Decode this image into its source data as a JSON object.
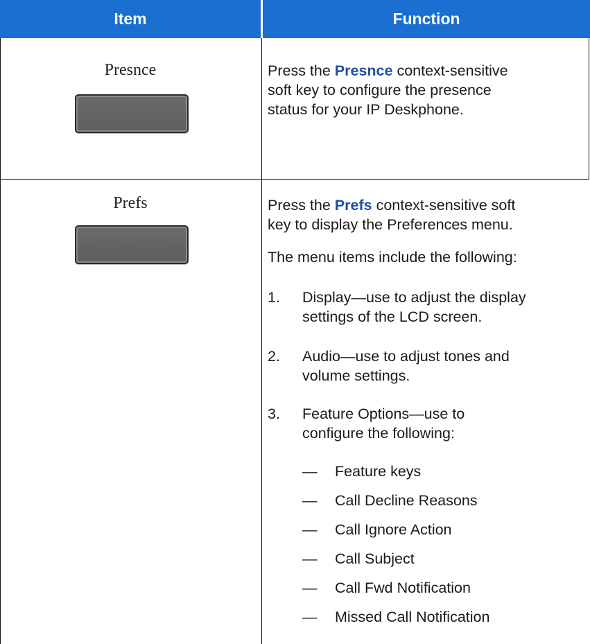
{
  "header": {
    "item": "Item",
    "function": "Function"
  },
  "colors": {
    "header_bg": "#1a6fd1",
    "keyword": "#1d4fa8",
    "softkey": "#646464"
  },
  "rows": [
    {
      "item_label": "Presnce",
      "icon": "softkey-button",
      "text_pre": "Press the ",
      "keyword": "Presnce",
      "text_post_lines": [
        " context-sensitive",
        "soft key to configure the presence",
        "status for your IP Deskphone."
      ]
    },
    {
      "item_label": "Prefs",
      "icon": "softkey-button",
      "text_pre": "Press the ",
      "keyword": "Prefs",
      "text_post_lines": [
        " context-sensitive soft",
        "key to display the Preferences menu."
      ],
      "intro": "The menu items include the following:",
      "numbered": [
        {
          "n": "1.",
          "lines": [
            "Display—use to adjust the display",
            "settings of the LCD screen."
          ]
        },
        {
          "n": "2.",
          "lines": [
            "Audio—use to adjust tones and",
            "volume settings."
          ]
        },
        {
          "n": "3.",
          "lines": [
            "Feature Options—use to",
            "configure the following:"
          ]
        }
      ],
      "dash": "—",
      "sub_items": [
        "Feature keys",
        "Call Decline Reasons",
        "Call Ignore Action",
        "Call Subject",
        "Call Fwd Notification",
        "Missed Call Notification"
      ]
    }
  ]
}
